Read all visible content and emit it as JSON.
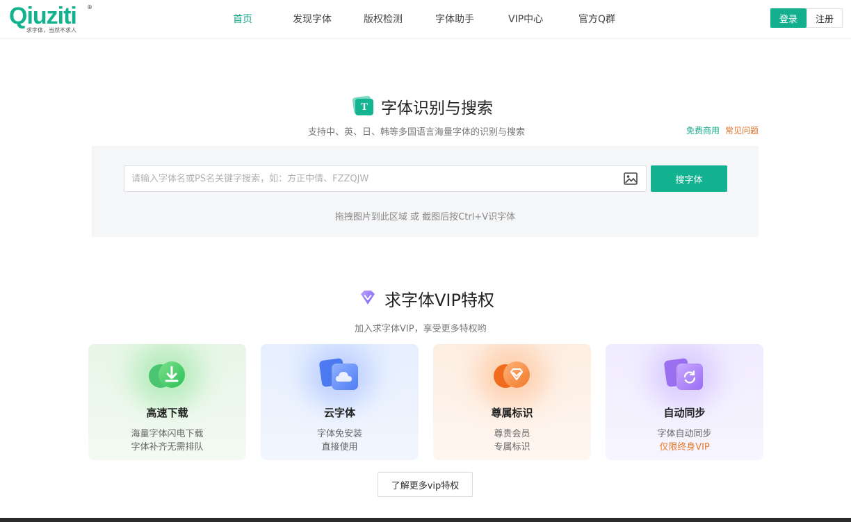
{
  "header": {
    "logo_text": "Qiuziti",
    "logo_reg": "®",
    "logo_slogan": "求字体，当然不求人",
    "nav": [
      {
        "label": "首页",
        "active": true
      },
      {
        "label": "发现字体"
      },
      {
        "label": "版权检测"
      },
      {
        "label": "字体助手"
      },
      {
        "label": "VIP中心"
      },
      {
        "label": "官方Q群"
      }
    ],
    "login_label": "登录",
    "register_label": "注册"
  },
  "recognition": {
    "icon_letter": "T",
    "title": "字体识别与搜索",
    "subtitle": "支持中、英、日、韩等多国语言海量字体的识别与搜索",
    "link_free": "免费商用",
    "link_faq": "常见问题",
    "search_placeholder": "请输入字体名或PS名关键字搜索，如：方正中倩、FZZQJW",
    "search_button": "搜字体",
    "drag_hint": "拖拽图片到此区域 或 截图后按Ctrl+V识字体"
  },
  "vip": {
    "title": "求字体VIP特权",
    "subtitle": "加入求字体VIP，享受更多特权哟",
    "cards": [
      {
        "title": "高速下载",
        "line1": "海量字体闪电下载",
        "line2": "字体补齐无需排队"
      },
      {
        "title": "云字体",
        "line1": "字体免安装",
        "line2": "直接使用"
      },
      {
        "title": "尊属标识",
        "line1": "尊贵会员",
        "line2": "专属标识"
      },
      {
        "title": "自动同步",
        "line1": "字体自动同步",
        "line2": "仅限终身VIP"
      }
    ],
    "more_button": "了解更多vip特权"
  },
  "colors": {
    "brand": "#14b08e",
    "accent_orange": "#e0712a"
  }
}
